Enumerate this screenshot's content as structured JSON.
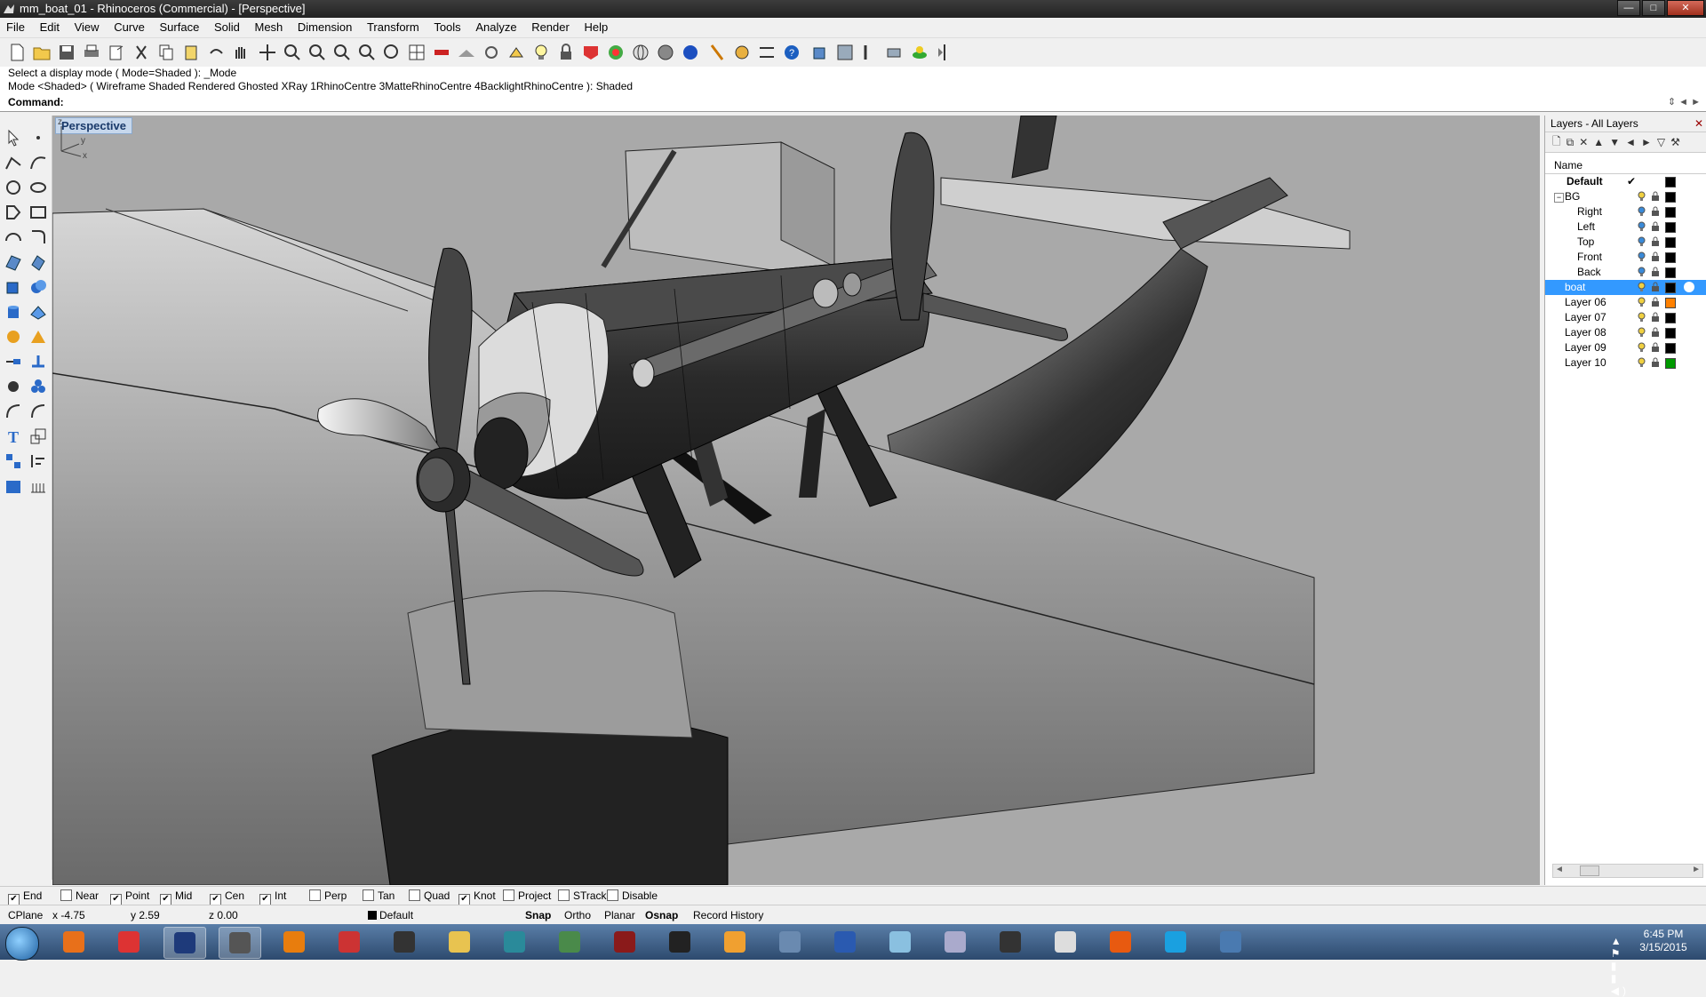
{
  "window": {
    "title": "mm_boat_01 - Rhinoceros (Commercial) - [Perspective]",
    "controls": [
      "—",
      "□",
      "✕"
    ]
  },
  "menu": [
    "File",
    "Edit",
    "View",
    "Curve",
    "Surface",
    "Solid",
    "Mesh",
    "Dimension",
    "Transform",
    "Tools",
    "Analyze",
    "Render",
    "Help"
  ],
  "command": {
    "history": [
      "Select a display mode ( Mode=Shaded ): _Mode",
      "Mode <Shaded> ( Wireframe  Shaded  Rendered  Ghosted  XRay  1RhinoCentre  3MatteRhinoCentre  4BacklightRhinoCentre ): Shaded"
    ],
    "label": "Command:",
    "value": ""
  },
  "viewport": {
    "title": "Perspective",
    "axes": {
      "z": "z",
      "y": "y",
      "x": "x"
    }
  },
  "layers_panel": {
    "title": "Layers - All Layers",
    "column_name": "Name",
    "layers": [
      {
        "name": "Default",
        "bold": true,
        "current": true,
        "color": "#000000"
      },
      {
        "name": "BG",
        "expanded": true,
        "color": "#000000"
      },
      {
        "name": "Right",
        "child": true,
        "color": "#000000"
      },
      {
        "name": "Left",
        "child": true,
        "color": "#000000"
      },
      {
        "name": "Top",
        "child": true,
        "color": "#000000"
      },
      {
        "name": "Front",
        "child": true,
        "color": "#000000"
      },
      {
        "name": "Back",
        "child": true,
        "color": "#000000"
      },
      {
        "name": "boat",
        "selected": true,
        "color": "#000000"
      },
      {
        "name": "Layer 06",
        "color": "#ff8000"
      },
      {
        "name": "Layer 07",
        "color": "#000000"
      },
      {
        "name": "Layer 08",
        "color": "#000000"
      },
      {
        "name": "Layer 09",
        "color": "#000000"
      },
      {
        "name": "Layer 10",
        "color": "#009900"
      }
    ]
  },
  "osnap": [
    {
      "label": "End",
      "checked": true
    },
    {
      "label": "Near",
      "checked": false
    },
    {
      "label": "Point",
      "checked": true
    },
    {
      "label": "Mid",
      "checked": true
    },
    {
      "label": "Cen",
      "checked": true
    },
    {
      "label": "Int",
      "checked": true
    },
    {
      "label": "Perp",
      "checked": false
    },
    {
      "label": "Tan",
      "checked": false
    },
    {
      "label": "Quad",
      "checked": false
    },
    {
      "label": "Knot",
      "checked": true
    },
    {
      "label": "Project",
      "checked": false
    },
    {
      "label": "STrack",
      "checked": false
    },
    {
      "label": "Disable",
      "checked": false
    }
  ],
  "status": {
    "cplane": "CPlane",
    "x": "x -4.75",
    "y": "y 2.59",
    "z": "z 0.00",
    "layer": "Default",
    "snap": "Snap",
    "ortho": "Ortho",
    "planar": "Planar",
    "osnap": "Osnap",
    "record_history": "Record History"
  },
  "taskbar": {
    "apps": [
      "firefox-icon",
      "chrome-icon",
      "photoshop-icon",
      "rhino-icon",
      "blender-icon",
      "sketchup-icon",
      "zbrush-icon",
      "folder-icon",
      "maya-icon",
      "substance-icon",
      "3dcoat-icon",
      "media-player-icon",
      "vlc-icon",
      "rhino-tools-icon",
      "word-icon",
      "notes-icon",
      "calculator-icon",
      "keyshot-icon",
      "unreal-icon",
      "origin-icon",
      "skype-icon",
      "rhino-app-icon"
    ],
    "app_colors": [
      "#e8701a",
      "#d33",
      "#1e3a7a",
      "#555",
      "#e87d0d",
      "#c33",
      "#333",
      "#e8c350",
      "#2a8a9a",
      "#4a8a4a",
      "#8a1a1a",
      "#222",
      "#f0a030",
      "#6a8ab0",
      "#2a5ab0",
      "#8ac0e0",
      "#aac",
      "#333",
      "#ddd",
      "#e85a10",
      "#1aa0e0",
      "#4a7ab0"
    ],
    "clock_time": "6:45 PM",
    "clock_date": "3/15/2015"
  }
}
